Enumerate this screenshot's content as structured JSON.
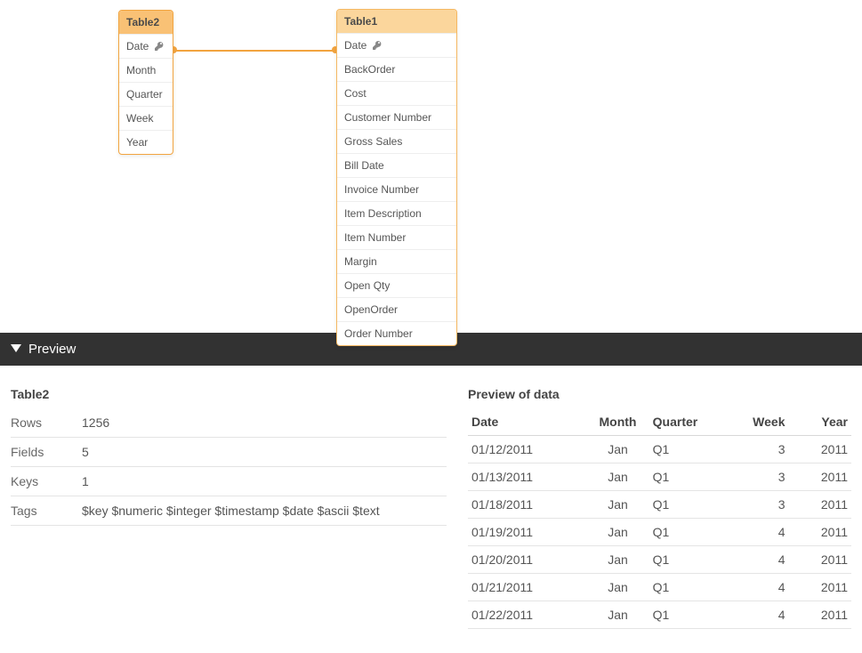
{
  "canvas": {
    "table2": {
      "title": "Table2",
      "fields": [
        "Date",
        "Month",
        "Quarter",
        "Week",
        "Year"
      ],
      "keyIndex": 0
    },
    "table1": {
      "title": "Table1",
      "fields": [
        "Date",
        "BackOrder",
        "Cost",
        "Customer Number",
        "Gross Sales",
        "Bill Date",
        "Invoice Number",
        "Item Description",
        "Item Number",
        "Margin",
        "Open Qty",
        "OpenOrder",
        "Order Number"
      ],
      "keyIndex": 0
    }
  },
  "previewBar": {
    "label": "Preview"
  },
  "meta": {
    "title": "Table2",
    "rowsLabel": "Rows",
    "rowsValue": "1256",
    "fieldsLabel": "Fields",
    "fieldsValue": "5",
    "keysLabel": "Keys",
    "keysValue": "1",
    "tagsLabel": "Tags",
    "tagsValue": "$key $numeric $integer $timestamp $date $ascii $text"
  },
  "dataPreview": {
    "title": "Preview of data",
    "headers": {
      "date": "Date",
      "month": "Month",
      "quarter": "Quarter",
      "week": "Week",
      "year": "Year"
    },
    "rows": [
      {
        "date": "01/12/2011",
        "month": "Jan",
        "quarter": "Q1",
        "week": "3",
        "year": "2011"
      },
      {
        "date": "01/13/2011",
        "month": "Jan",
        "quarter": "Q1",
        "week": "3",
        "year": "2011"
      },
      {
        "date": "01/18/2011",
        "month": "Jan",
        "quarter": "Q1",
        "week": "3",
        "year": "2011"
      },
      {
        "date": "01/19/2011",
        "month": "Jan",
        "quarter": "Q1",
        "week": "4",
        "year": "2011"
      },
      {
        "date": "01/20/2011",
        "month": "Jan",
        "quarter": "Q1",
        "week": "4",
        "year": "2011"
      },
      {
        "date": "01/21/2011",
        "month": "Jan",
        "quarter": "Q1",
        "week": "4",
        "year": "2011"
      },
      {
        "date": "01/22/2011",
        "month": "Jan",
        "quarter": "Q1",
        "week": "4",
        "year": "2011"
      }
    ]
  }
}
